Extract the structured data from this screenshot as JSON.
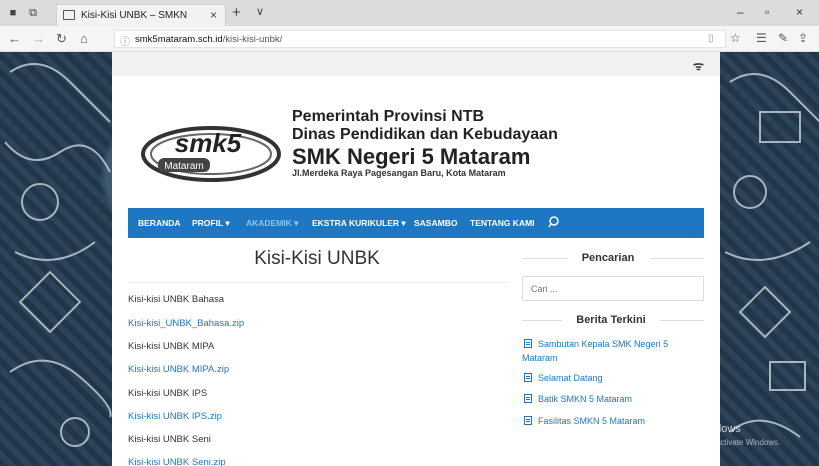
{
  "browser": {
    "tab_title": "Kisi-Kisi UNBK – SMKN",
    "tab_close": "×",
    "new_tab": "+",
    "tab_list": "∨",
    "url_host": "smk5mataram.sch.id",
    "url_path": "/kisi-kisi-unbk/",
    "window_controls": [
      "–",
      "▫",
      "×"
    ]
  },
  "header": {
    "line1": "Pemerintah Provinsi NTB",
    "line2": "Dinas Pendidikan dan Kebudayaan",
    "line3": "SMK Negeri 5 Mataram",
    "line4": "Jl.Merdeka Raya Pagesangan Baru, Kota Mataram",
    "logo_text": "smk5",
    "logo_sub": "Mataram"
  },
  "menu": {
    "items": [
      {
        "label": "BERANDA"
      },
      {
        "label": "PROFIL ▾"
      },
      {
        "label": "AKADEMIK ▾"
      },
      {
        "label": "EKSTRA KURIKULER ▾"
      },
      {
        "label": "SASAMBO"
      },
      {
        "label": "TENTANG KAMI"
      }
    ],
    "active_index": 2
  },
  "main": {
    "title": "Kisi-Kisi UNBK",
    "items": [
      {
        "label": "Kisi-kisi UNBK Bahasa",
        "type": "text"
      },
      {
        "label": "Kisi-kisi_UNBK_Bahasa.zip",
        "type": "link"
      },
      {
        "label": "Kisi-kisi UNBK MIPA",
        "type": "text"
      },
      {
        "label": "Kisi-kisi UNBK MIPA.zip",
        "type": "link"
      },
      {
        "label": "Kisi-kisi UNBK IPS",
        "type": "text"
      },
      {
        "label": "Kisi-kisi UNBK IPS.zip",
        "type": "link"
      },
      {
        "label": "Kisi-kisi UNBK Seni",
        "type": "text"
      },
      {
        "label": "Kisi-kisi UNBK Seni.zip",
        "type": "link"
      }
    ]
  },
  "sidebar": {
    "search_heading": "Pencarian",
    "search_placeholder": "Cari ...",
    "news_heading": "Berita Terkini",
    "posts": [
      {
        "line1": "Sambutan Kepala SMK Negeri 5",
        "line2": "Mataram"
      },
      {
        "line1": "Selamat Datang"
      },
      {
        "line1": "Batik SMKN 5 Mataram"
      },
      {
        "line1": "Fasilitas SMKN 5 Mataram"
      }
    ]
  },
  "watermark": {
    "title": "Activate Windows",
    "subtitle": "Go to Settings to activate Windows."
  },
  "colors": {
    "menu_bg": "#1e77c2",
    "link": "#1e77c2",
    "active_menu": "#8fc5ef"
  }
}
